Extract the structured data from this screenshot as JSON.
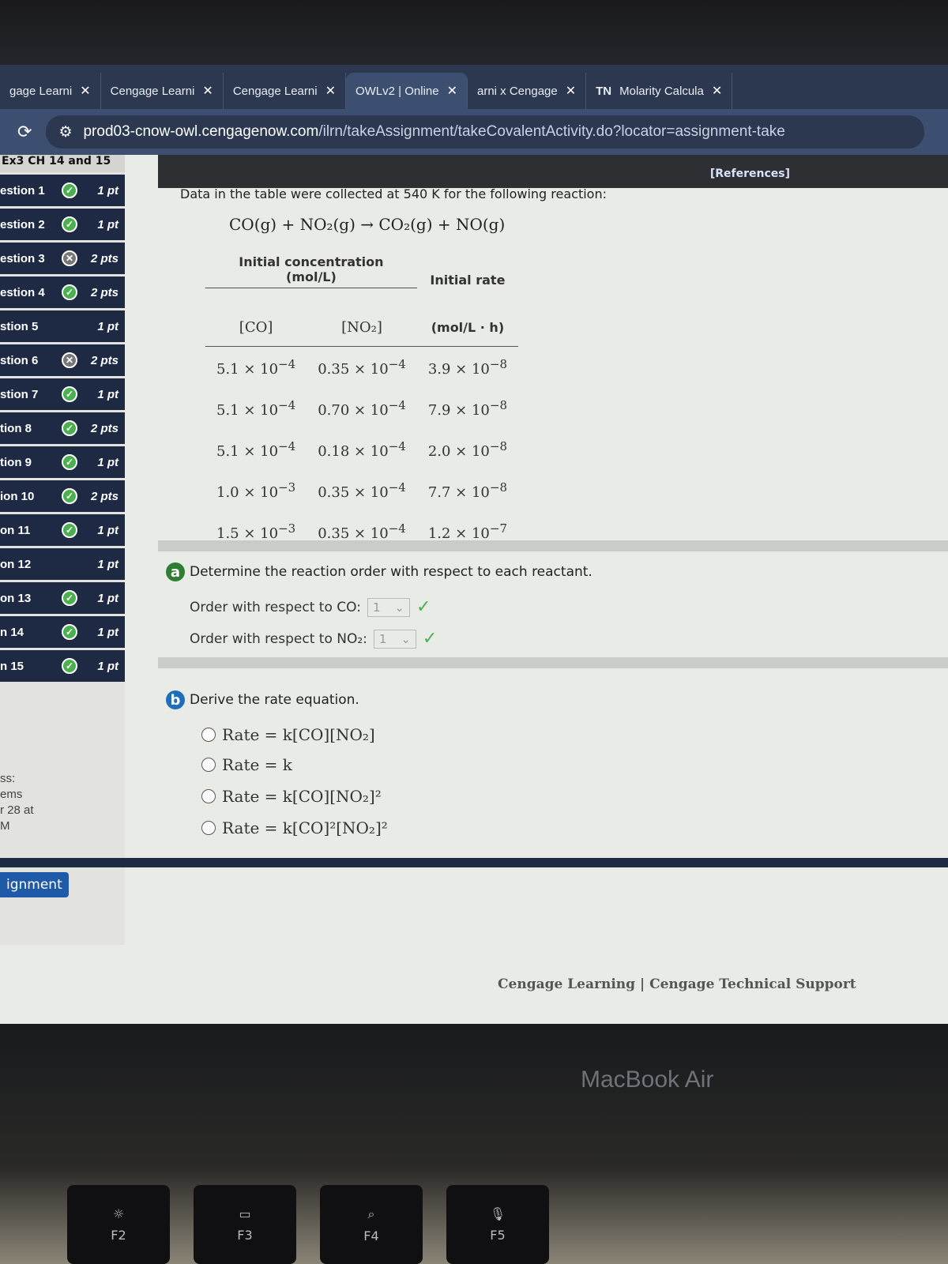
{
  "browser": {
    "tabs": [
      {
        "title": "gage Learni",
        "active": false
      },
      {
        "title": "Cengage Learni",
        "active": false
      },
      {
        "title": "Cengage Learni",
        "active": false
      },
      {
        "title": "OWLv2 | Online",
        "active": true
      },
      {
        "title": "arni x Cengage",
        "active": false
      },
      {
        "title": "Molarity Calcula",
        "active": false,
        "favicon": "TN"
      }
    ],
    "url_host": "prod03-cnow-owl.cengagenow.com",
    "url_path": "/ilrn/takeAssignment/takeCovalentActivity.do?locator=assignment-take"
  },
  "sidebar": {
    "title": "Ex3 CH 14 and 15",
    "questions": [
      {
        "label": "estion 1",
        "status": "correct",
        "points": "1 pt"
      },
      {
        "label": "estion 2",
        "status": "correct",
        "points": "1 pt"
      },
      {
        "label": "estion 3",
        "status": "incorrect",
        "points": "2 pts"
      },
      {
        "label": "estion 4",
        "status": "correct",
        "points": "2 pts"
      },
      {
        "label": "stion 5",
        "status": "none",
        "points": "1 pt"
      },
      {
        "label": "stion 6",
        "status": "incorrect",
        "points": "2 pts"
      },
      {
        "label": "stion 7",
        "status": "correct",
        "points": "1 pt"
      },
      {
        "label": "tion 8",
        "status": "correct",
        "points": "2 pts"
      },
      {
        "label": "tion 9",
        "status": "correct",
        "points": "1 pt"
      },
      {
        "label": "ion 10",
        "status": "correct",
        "points": "2 pts"
      },
      {
        "label": "on 11",
        "status": "correct",
        "points": "1 pt"
      },
      {
        "label": "on 12",
        "status": "none",
        "points": "1 pt"
      },
      {
        "label": "on 13",
        "status": "correct",
        "points": "1 pt"
      },
      {
        "label": "n 14",
        "status": "correct",
        "points": "1 pt"
      },
      {
        "label": "n 15",
        "status": "correct",
        "points": "1 pt"
      }
    ],
    "progress": [
      "ss:",
      "ems",
      "r 28 at",
      "M"
    ],
    "assignment_button": "ignment"
  },
  "main": {
    "references": "[References]",
    "intro": "Data in the table were collected at 540 K for the following reaction:",
    "reaction": "CO(g) + NO₂(g) → CO₂(g) + NO(g)",
    "table": {
      "h_conc": "Initial concentration",
      "h_conc_unit": "(mol/L)",
      "h_rate": "Initial rate",
      "col_co": "[CO]",
      "col_no2": "[NO₂]",
      "rate_unit": "(mol/L · h)",
      "rows": [
        {
          "co": "5.1 × 10",
          "co_exp": "−4",
          "no2": "0.35 × 10",
          "no2_exp": "−4",
          "rate": "3.9 × 10",
          "rate_exp": "−8"
        },
        {
          "co": "5.1 × 10",
          "co_exp": "−4",
          "no2": "0.70 × 10",
          "no2_exp": "−4",
          "rate": "7.9 × 10",
          "rate_exp": "−8"
        },
        {
          "co": "5.1 × 10",
          "co_exp": "−4",
          "no2": "0.18 × 10",
          "no2_exp": "−4",
          "rate": "2.0 × 10",
          "rate_exp": "−8"
        },
        {
          "co": "1.0 × 10",
          "co_exp": "−3",
          "no2": "0.35 × 10",
          "no2_exp": "−4",
          "rate": "7.7 × 10",
          "rate_exp": "−8"
        },
        {
          "co": "1.5 × 10",
          "co_exp": "−3",
          "no2": "0.35 × 10",
          "no2_exp": "−4",
          "rate": "1.2 × 10",
          "rate_exp": "−7"
        }
      ]
    },
    "part_a": {
      "badge": "a",
      "prompt": "Determine the reaction order with respect to each reactant.",
      "co_label": "Order with respect to CO:",
      "co_value": "1",
      "no2_label": "Order with respect to NO₂:",
      "no2_value": "1",
      "badge_color": "#2e7d32"
    },
    "part_b": {
      "badge": "b",
      "prompt": "Derive the rate equation.",
      "badge_color": "#1f6fb8",
      "options": [
        "Rate = k[CO][NO₂]",
        "Rate = k",
        "Rate = k[CO][NO₂]²",
        "Rate = k[CO]²[NO₂]²"
      ]
    },
    "footer": {
      "left": "Cengage Learning",
      "sep": "|",
      "right": "Cengage Technical Support"
    }
  },
  "device": {
    "brand": "MacBook Air",
    "keys": [
      "F2",
      "F3",
      "F4",
      "F5"
    ]
  }
}
